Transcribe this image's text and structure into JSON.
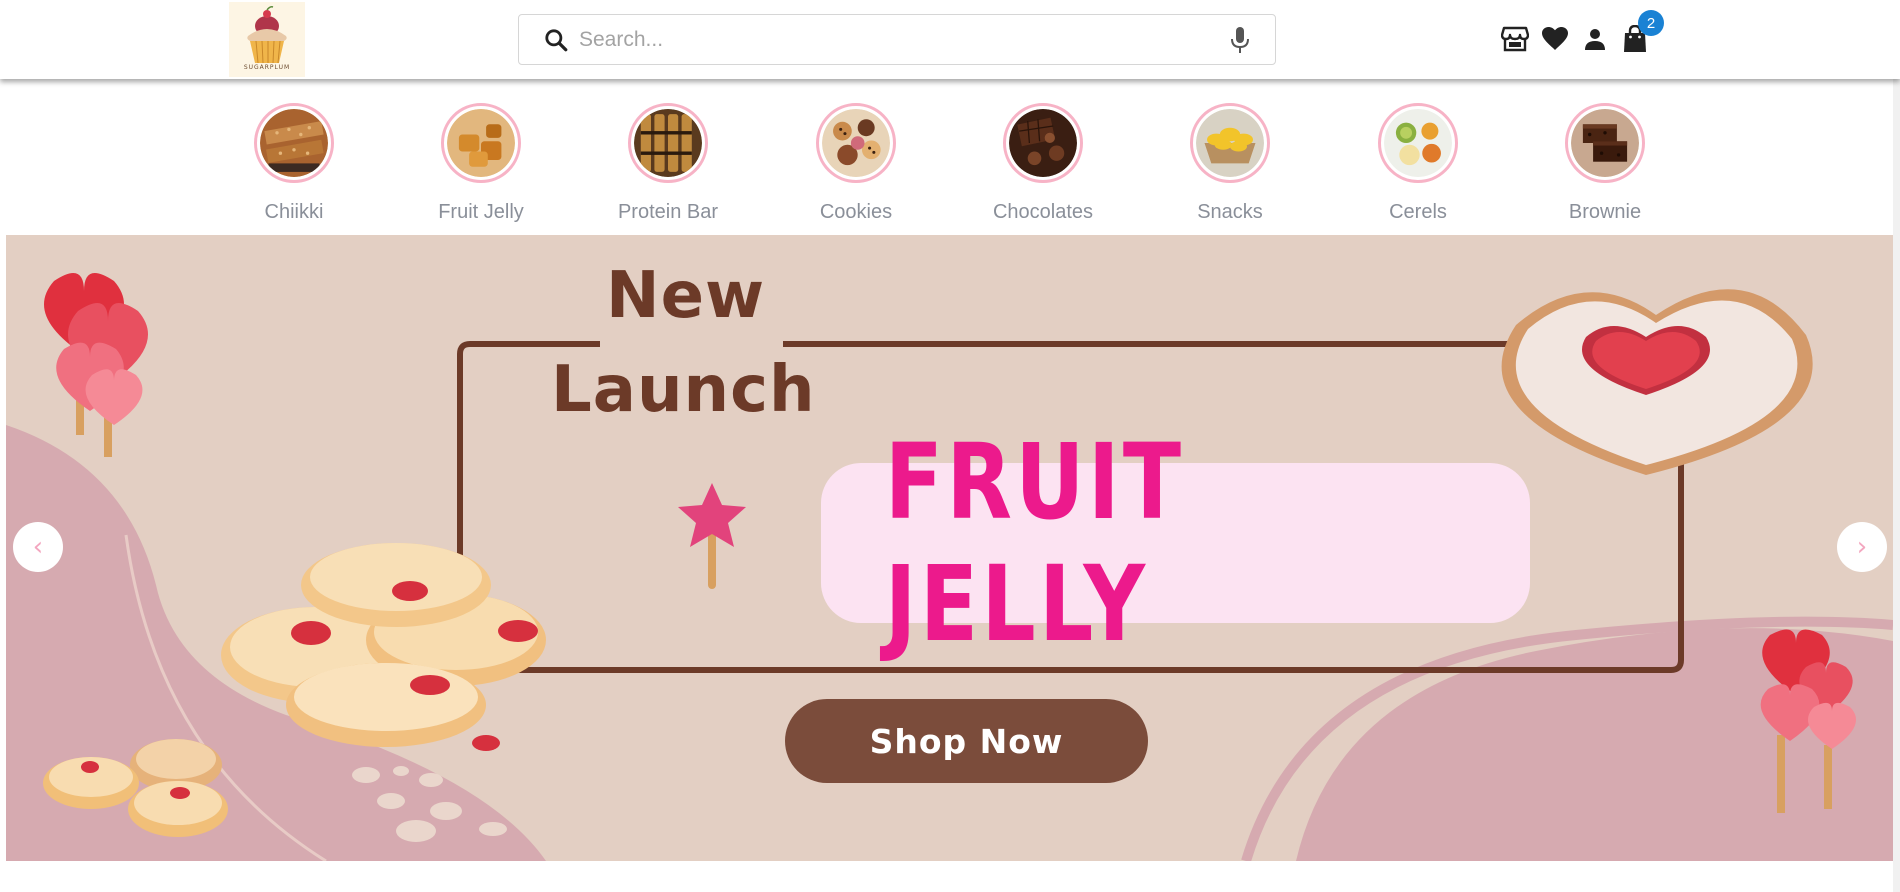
{
  "header": {
    "logo_alt": "Sugarplum logo",
    "logo_text": "SUGARPLUM",
    "search_placeholder": "Search...",
    "icons": [
      "store-icon",
      "heart-icon",
      "account-icon",
      "shopping-bag-icon"
    ],
    "cart_count": "2"
  },
  "categories": [
    {
      "label": "Chiikki"
    },
    {
      "label": "Fruit Jelly"
    },
    {
      "label": "Protein Bar"
    },
    {
      "label": "Cookies"
    },
    {
      "label": "Chocolates"
    },
    {
      "label": "Snacks"
    },
    {
      "label": "Cerels"
    },
    {
      "label": "Brownie"
    }
  ],
  "banner": {
    "headline_line1": "New",
    "headline_line2": "Launch",
    "product": "FRUIT JELLY",
    "cta": "Shop Now",
    "prev_label": "‹",
    "next_label": "›"
  },
  "colors": {
    "accent_pink": "#ec1a8c",
    "brown": "#6c3a28",
    "badge_blue": "#1a82d4",
    "category_ring": "#f7b3c6"
  }
}
